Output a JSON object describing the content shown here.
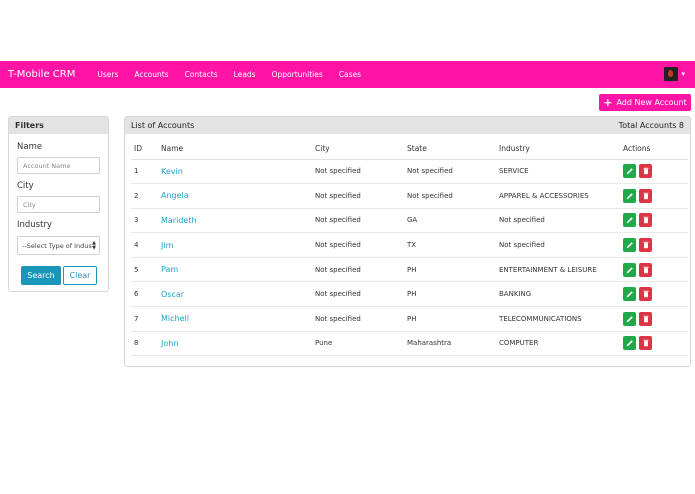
{
  "nav": {
    "brand": "T-Mobile CRM",
    "links": [
      "Users",
      "Accounts",
      "Contacts",
      "Leads",
      "Opportunities",
      "Cases"
    ],
    "caret": "▾",
    "brand_color": "#ff14a6"
  },
  "add_account_label": "Add New Account",
  "filters": {
    "title": "Filters",
    "name_label": "Name",
    "name_placeholder": "Account Name",
    "city_label": "City",
    "city_placeholder": "City",
    "industry_label": "Industry",
    "industry_selected": "--Select Type of Indus",
    "search_label": "Search",
    "clear_label": "Clear"
  },
  "accounts": {
    "title": "List of Accounts",
    "total": "Total Accounts 8",
    "columns": [
      "ID",
      "Name",
      "City",
      "State",
      "Industry",
      "Actions"
    ],
    "rows": [
      {
        "id": "1",
        "name": "Kevin",
        "city": "Not specified",
        "state": "Not specified",
        "industry": "SERVICE"
      },
      {
        "id": "2",
        "name": "Angela",
        "city": "Not specified",
        "state": "Not specified",
        "industry": "APPAREL & ACCESSORIES"
      },
      {
        "id": "3",
        "name": "Marideth",
        "city": "Not specified",
        "state": "GA",
        "industry": "Not specified"
      },
      {
        "id": "4",
        "name": "Jim",
        "city": "Not specified",
        "state": "TX",
        "industry": "Not specified"
      },
      {
        "id": "5",
        "name": "Pam",
        "city": "Not specified",
        "state": "PH",
        "industry": "ENTERTAINMENT & LEISURE"
      },
      {
        "id": "6",
        "name": "Oscar",
        "city": "Not specified",
        "state": "PH",
        "industry": "BANKING"
      },
      {
        "id": "7",
        "name": "Michell",
        "city": "Not specified",
        "state": "PH",
        "industry": "TELECOMMUNICATIONS"
      },
      {
        "id": "8",
        "name": "John",
        "city": "Pune",
        "state": "Maharashtra",
        "industry": "COMPUTER"
      }
    ]
  }
}
